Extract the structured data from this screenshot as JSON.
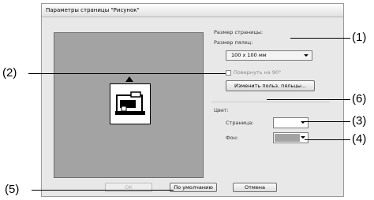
{
  "dialog": {
    "title": "Параметры страницы \"Рисунок\""
  },
  "page_size": {
    "group_label": "Размер страницы:",
    "hoop_label": "Размер пялец:",
    "hoop_value": "100 x 100 мм",
    "rotate_label": "Повернуть на 90°",
    "change_button": "Изменить польз. пяльцы..."
  },
  "color": {
    "group_label": "Цвет:",
    "page_label": "Страница:",
    "page_color": "#ffffff",
    "background_label": "Фон:",
    "background_color": "#a3a3a3"
  },
  "buttons": {
    "ok": "ОК",
    "default": "По умолчанию",
    "cancel": "Отмена"
  },
  "callouts": [
    "(1)",
    "(2)",
    "(3)",
    "(4)",
    "(5)",
    "(6)"
  ]
}
